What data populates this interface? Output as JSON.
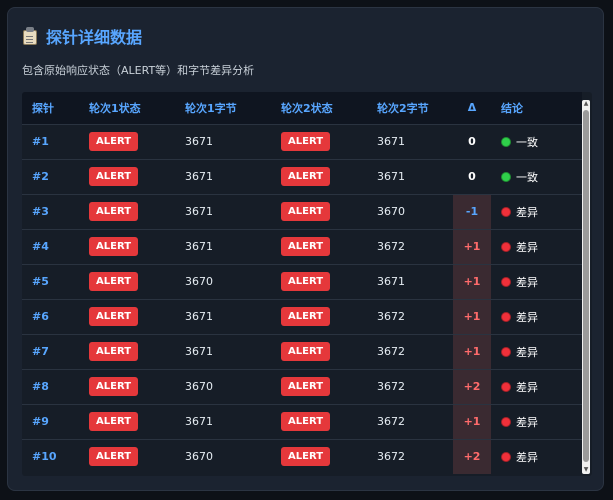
{
  "header": {
    "title": "探针详细数据",
    "icon": "clipboard-icon"
  },
  "subtitle": "包含原始响应状态（ALERT等）和字节差异分析",
  "table": {
    "columns": [
      "探针",
      "轮次1状态",
      "轮次1字节",
      "轮次2状态",
      "轮次2字节",
      "Δ",
      "结论"
    ],
    "rows": [
      {
        "probe": "#1",
        "s1": "ALERT",
        "b1": "3671",
        "s2": "ALERT",
        "b2": "3671",
        "delta": "0",
        "verdict": "一致",
        "kind": "same"
      },
      {
        "probe": "#2",
        "s1": "ALERT",
        "b1": "3671",
        "s2": "ALERT",
        "b2": "3671",
        "delta": "0",
        "verdict": "一致",
        "kind": "same"
      },
      {
        "probe": "#3",
        "s1": "ALERT",
        "b1": "3671",
        "s2": "ALERT",
        "b2": "3670",
        "delta": "-1",
        "verdict": "差异",
        "kind": "neg"
      },
      {
        "probe": "#4",
        "s1": "ALERT",
        "b1": "3671",
        "s2": "ALERT",
        "b2": "3672",
        "delta": "+1",
        "verdict": "差异",
        "kind": "diff"
      },
      {
        "probe": "#5",
        "s1": "ALERT",
        "b1": "3670",
        "s2": "ALERT",
        "b2": "3671",
        "delta": "+1",
        "verdict": "差异",
        "kind": "diff"
      },
      {
        "probe": "#6",
        "s1": "ALERT",
        "b1": "3671",
        "s2": "ALERT",
        "b2": "3672",
        "delta": "+1",
        "verdict": "差异",
        "kind": "diff"
      },
      {
        "probe": "#7",
        "s1": "ALERT",
        "b1": "3671",
        "s2": "ALERT",
        "b2": "3672",
        "delta": "+1",
        "verdict": "差异",
        "kind": "diff"
      },
      {
        "probe": "#8",
        "s1": "ALERT",
        "b1": "3670",
        "s2": "ALERT",
        "b2": "3672",
        "delta": "+2",
        "verdict": "差异",
        "kind": "diff"
      },
      {
        "probe": "#9",
        "s1": "ALERT",
        "b1": "3671",
        "s2": "ALERT",
        "b2": "3672",
        "delta": "+1",
        "verdict": "差异",
        "kind": "diff"
      },
      {
        "probe": "#10",
        "s1": "ALERT",
        "b1": "3670",
        "s2": "ALERT",
        "b2": "3672",
        "delta": "+2",
        "verdict": "差异",
        "kind": "diff"
      }
    ]
  },
  "colors": {
    "accent": "#58a6ff",
    "alert": "#e5383b",
    "ok": "#2fd04a",
    "bad": "#f0303a"
  }
}
